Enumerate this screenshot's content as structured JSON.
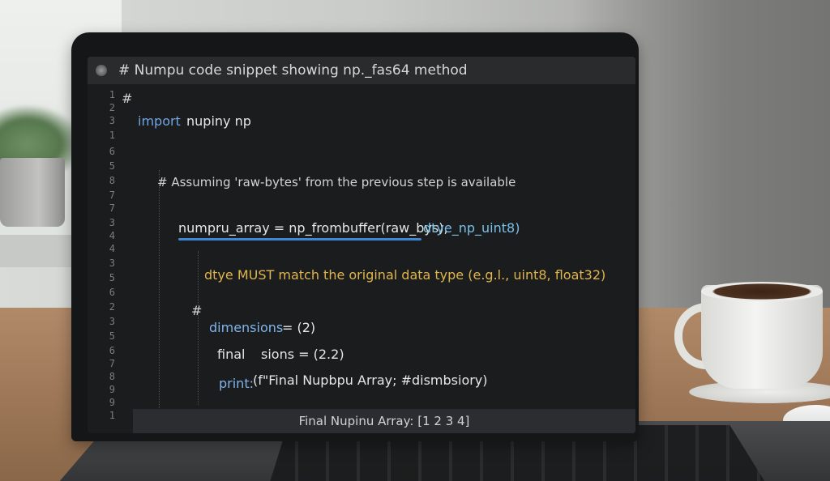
{
  "window": {
    "title": "# Numpu code snippet showing np._fas64 method"
  },
  "editor": {
    "line_numbers": [
      "1",
      "2",
      "3",
      "1",
      "6",
      "5",
      "8",
      "7",
      "7",
      "3",
      "4",
      "4",
      "3",
      "5",
      "6",
      "2",
      "3",
      "5",
      "6",
      "7",
      "8",
      "9",
      "9",
      "1"
    ],
    "lines": {
      "hash_top": "#",
      "import": "import",
      "import_rest": "nupiny np",
      "comment_assume": "# Assuming 'raw-bytes' from the previous step is available",
      "assign_lhs": "numpru_array = np_frombuffer(raw_bys),",
      "assign_dtype": "dtye_np_uint8)",
      "dtype_note": "dtye MUST match the original data type (e.g.l., uint8, float32)",
      "hash_mid": "#",
      "dims": "dimensions",
      "dims_val": "= (2)",
      "final": "final",
      "final_rest": "sions = (2.2)",
      "print_kw": "print:",
      "print_rest": "(f\"Final Nupbpu Array; #dismbsiory)",
      "hash_bottom": "#"
    }
  },
  "status": {
    "output": "Final Nupinu Array: [1 2 3 4]"
  },
  "colors": {
    "keyword": "#6fa6e6",
    "warning_text": "#e0b54b",
    "error_underline": "#3f86d6",
    "editor_bg": "#1b1c1e"
  }
}
